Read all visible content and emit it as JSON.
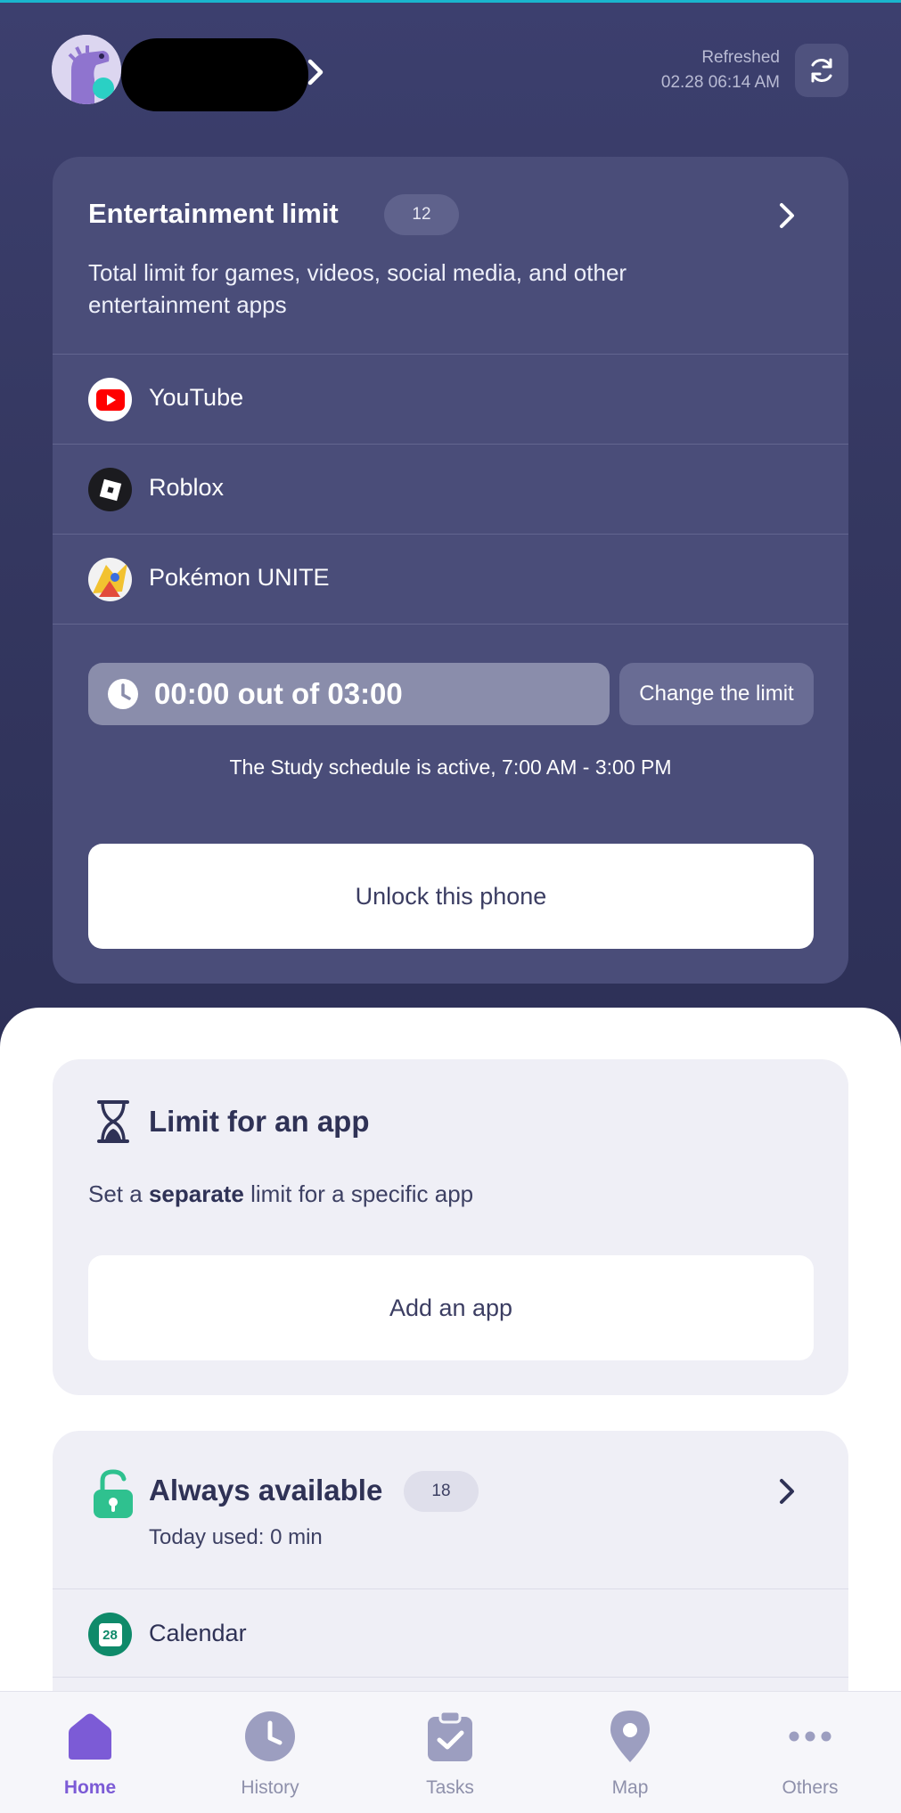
{
  "header": {
    "refreshed_label": "Refreshed",
    "refreshed_time": "02.28 06:14 AM"
  },
  "entertainment": {
    "title": "Entertainment limit",
    "count": "12",
    "description": "Total limit for games, videos, social media, and other entertainment apps",
    "apps": [
      {
        "name": "YouTube",
        "icon": "youtube-icon"
      },
      {
        "name": "Roblox",
        "icon": "roblox-icon"
      },
      {
        "name": "Pokémon UNITE",
        "icon": "pokemon-unite-icon"
      }
    ],
    "usage": "00:00 out of 03:00",
    "change_label": "Change the limit",
    "schedule": "The Study schedule is active, 7:00 AM - 3:00 PM",
    "unlock_label": "Unlock this phone"
  },
  "app_limit": {
    "title": "Limit for an app",
    "desc_prefix": "Set a ",
    "desc_bold": "separate",
    "desc_suffix": " limit for a specific app",
    "add_label": "Add an app"
  },
  "always_available": {
    "title": "Always available",
    "count": "18",
    "used": "Today used: 0 min",
    "apps": [
      {
        "name": "Calendar",
        "icon": "calendar-icon",
        "icon_text": "28"
      }
    ]
  },
  "nav": {
    "items": [
      {
        "label": "Home",
        "icon": "home-icon",
        "active": true
      },
      {
        "label": "History",
        "icon": "clock-icon",
        "active": false
      },
      {
        "label": "Tasks",
        "icon": "tasks-icon",
        "active": false
      },
      {
        "label": "Map",
        "icon": "map-pin-icon",
        "active": false
      },
      {
        "label": "Others",
        "icon": "more-icon",
        "active": false
      }
    ]
  },
  "colors": {
    "header_bg": "#3c3f6e",
    "accent": "#7c5bd6",
    "lock_green": "#2fc18f"
  }
}
